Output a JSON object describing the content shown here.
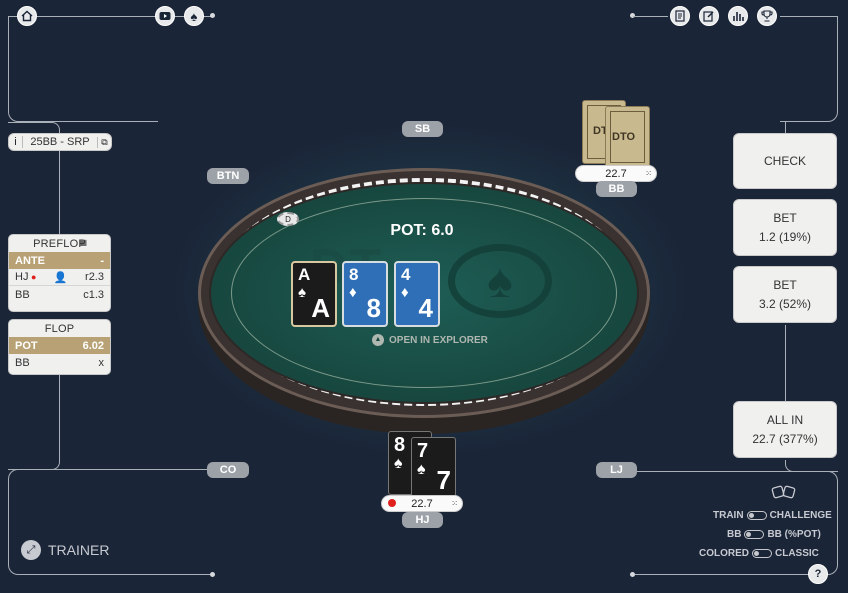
{
  "top_icons": {
    "home": "home-icon",
    "youtube": "youtube-icon",
    "spade": "spade-icon",
    "notes": "notes-icon",
    "edit": "edit-icon",
    "stats": "stats-icon",
    "trophy": "trophy-icon"
  },
  "scenario": {
    "info": "i",
    "label": "25BB - SRP",
    "copy": "⧉"
  },
  "seats": {
    "sb": "SB",
    "bb": "BB",
    "btn": "BTN",
    "co": "CO",
    "lj": "LJ",
    "hj": "HJ"
  },
  "table": {
    "pot": "POT: 6.0",
    "explorer": "OPEN IN EXPLORER",
    "dealer": "D",
    "logo": "DTO"
  },
  "board": [
    {
      "rank": "A",
      "suit": "♠",
      "color": "#1b1b1b"
    },
    {
      "rank": "8",
      "suit": "♦",
      "color": "#2f6fb8"
    },
    {
      "rank": "4",
      "suit": "♦",
      "color": "#2f6fb8"
    }
  ],
  "hero": {
    "stack": "22.7",
    "cards": [
      {
        "rank": "8",
        "suit": "♠"
      },
      {
        "rank": "7",
        "suit": "♠"
      }
    ]
  },
  "villain": {
    "stack": "22.7",
    "card_logo": "DTO"
  },
  "preflop": {
    "title": "PREFLOP",
    "ante_label": "ANTE",
    "ante_value": "-",
    "rows": [
      {
        "pos": "HJ",
        "action": "r2.3"
      },
      {
        "pos": "BB",
        "action": "c1.3"
      }
    ]
  },
  "flop": {
    "title": "FLOP",
    "pot_label": "POT",
    "pot_value": "6.02",
    "rows": [
      {
        "pos": "BB",
        "action": "x"
      }
    ]
  },
  "actions": {
    "check": "CHECK",
    "bet1_label": "BET",
    "bet1_value": "1.2 (19%)",
    "bet2_label": "BET",
    "bet2_value": "3.2 (52%)",
    "allin_label": "ALL IN",
    "allin_value": "22.7 (377%)"
  },
  "options": {
    "train": "TRAIN",
    "challenge": "CHALLENGE",
    "bb": "BB",
    "bb_pot": "BB (%POT)",
    "colored": "COLORED",
    "classic": "CLASSIC"
  },
  "trainer": "TRAINER",
  "help": "?"
}
